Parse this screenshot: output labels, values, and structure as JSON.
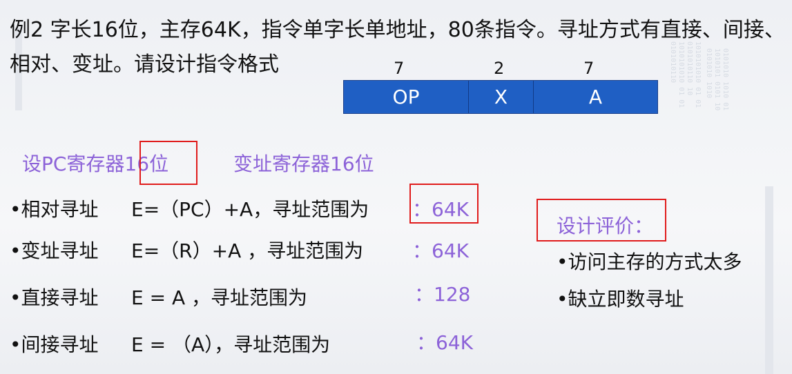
{
  "title_line1": "例2 字长16位，主存64K，指令单字长单地址，80条指令。寻址方式有直接、间接、",
  "title_line2": "相对、变址。请设计指令格式",
  "format": {
    "bits": [
      "7",
      "2",
      "7"
    ],
    "fields": [
      "OP",
      "X",
      "A"
    ]
  },
  "registers": {
    "pc": "设PC寄存器16位",
    "index": "变址寄存器16位"
  },
  "modes": [
    {
      "bullet": "•",
      "name": "相对寻址",
      "formula": "E=（PC）+A，寻址范围为",
      "range": "：64K"
    },
    {
      "bullet": "•",
      "name": "变址寻址",
      "formula": "E=（R）+A ，寻址范围为",
      "range": "：64K"
    },
    {
      "bullet": "•",
      "name": "直接寻址",
      "formula": "E = A ，寻址范围为",
      "range": "：128"
    },
    {
      "bullet": "•",
      "name": "间接寻址",
      "formula": "E = （A），寻址范围为",
      "range": "：64K"
    }
  ],
  "evaluation": {
    "heading": "设计评价：",
    "items": [
      "•访问主存的方式太多",
      "•缺立即数寻址"
    ]
  },
  "colors": {
    "field_blue": "#1f5fc4",
    "accent_purple": "#8c62d8",
    "highlight_red": "#e01b1b"
  }
}
